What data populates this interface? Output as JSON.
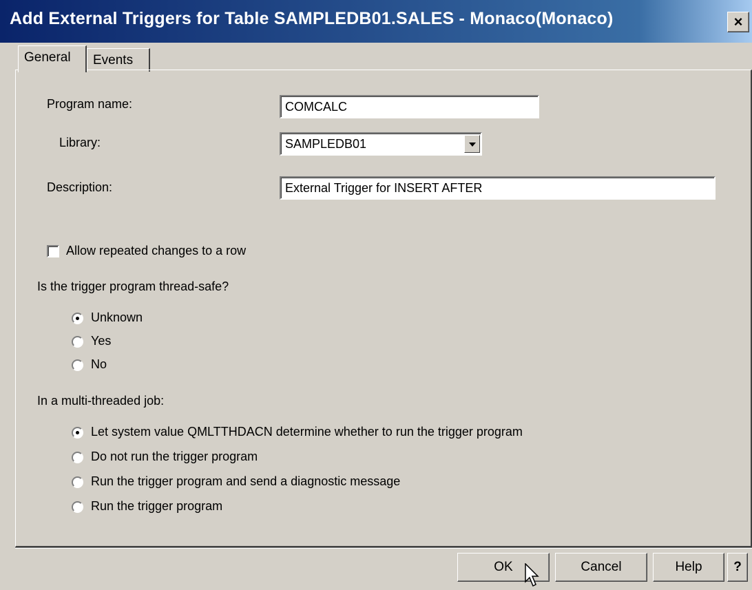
{
  "window": {
    "title": "Add External Triggers for Table  SAMPLEDB01.SALES   - Monaco(Monaco)",
    "close_label": "×"
  },
  "tabs": [
    {
      "label": "General",
      "selected": true
    },
    {
      "label": "Events",
      "selected": false
    }
  ],
  "form": {
    "program_name_label": "Program name:",
    "program_name_value": "COMCALC",
    "library_label": "Library:",
    "library_value": "SAMPLEDB01",
    "description_label": "Description:",
    "description_value": "External Trigger for INSERT AFTER",
    "allow_repeated_label": "Allow repeated changes to a row",
    "allow_repeated_checked": false,
    "threadsafe_question": "Is the trigger program thread-safe?",
    "threadsafe_options": [
      {
        "label": "Unknown",
        "checked": true
      },
      {
        "label": "Yes",
        "checked": false
      },
      {
        "label": "No",
        "checked": false
      }
    ],
    "multithread_question": "In a multi-threaded job:",
    "multithread_options": [
      {
        "label": "Let system value QMLTTHDACN determine whether to run the trigger program",
        "checked": true
      },
      {
        "label": "Do not run the trigger program",
        "checked": false
      },
      {
        "label": "Run the trigger program and send a diagnostic message",
        "checked": false
      },
      {
        "label": "Run the trigger program",
        "checked": false
      }
    ]
  },
  "buttons": {
    "ok": "OK",
    "cancel": "Cancel",
    "help": "Help",
    "context_help": "?"
  }
}
